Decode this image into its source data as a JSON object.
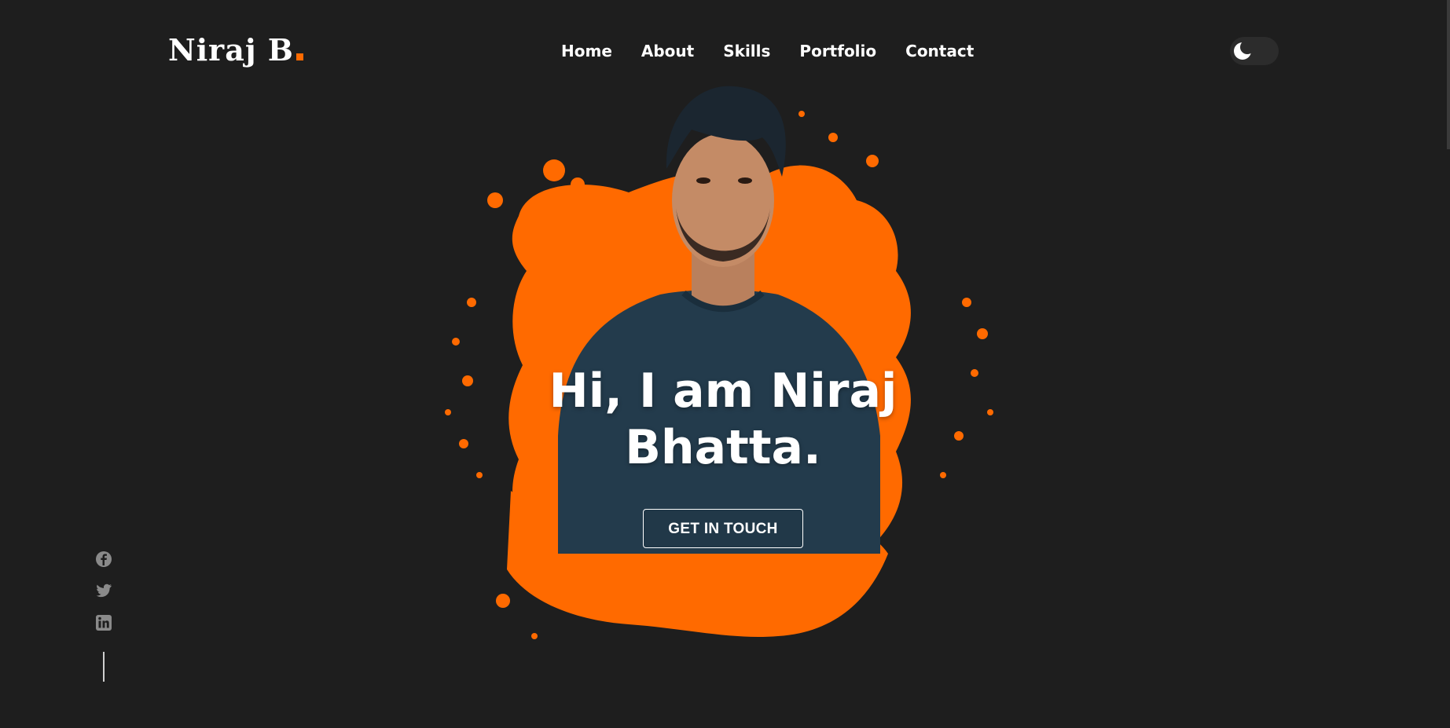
{
  "header": {
    "logo_text": "Niraj B",
    "nav": [
      "Home",
      "About",
      "Skills",
      "Portfolio",
      "Contact"
    ],
    "theme_toggle_icon": "moon-icon"
  },
  "hero": {
    "title_line1": "Hi, I am Niraj",
    "title_line2": "Bhatta.",
    "cta_label": "GET IN TOUCH",
    "image": "person-with-orange-splash"
  },
  "social": {
    "icons": [
      "facebook-icon",
      "twitter-icon",
      "linkedin-icon"
    ]
  },
  "colors": {
    "background": "#1e1e1e",
    "accent": "#ff6a00",
    "text": "#ffffff",
    "shirt": "#233b4c"
  }
}
